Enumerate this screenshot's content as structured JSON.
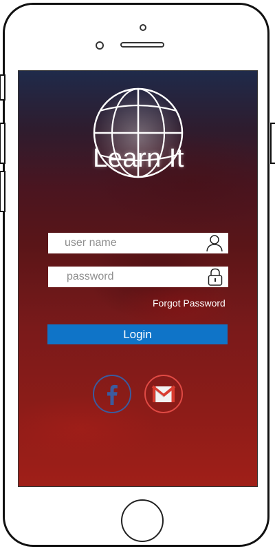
{
  "app": {
    "title": "Learn It"
  },
  "login_form": {
    "username_placeholder": "user name",
    "password_placeholder": "password",
    "forgot_password_label": "Forgot Password",
    "login_label": "Login"
  },
  "icons": {
    "logo": "globe-icon",
    "username": "user-icon",
    "password": "lock-icon",
    "facebook": "facebook-icon",
    "gmail": "gmail-icon"
  },
  "colors": {
    "login_button": "#0f74c8",
    "facebook": "#3b5b9e",
    "gmail": "#e04a44",
    "background_top": "#1f2a4a",
    "background_bottom": "#a01f18"
  }
}
